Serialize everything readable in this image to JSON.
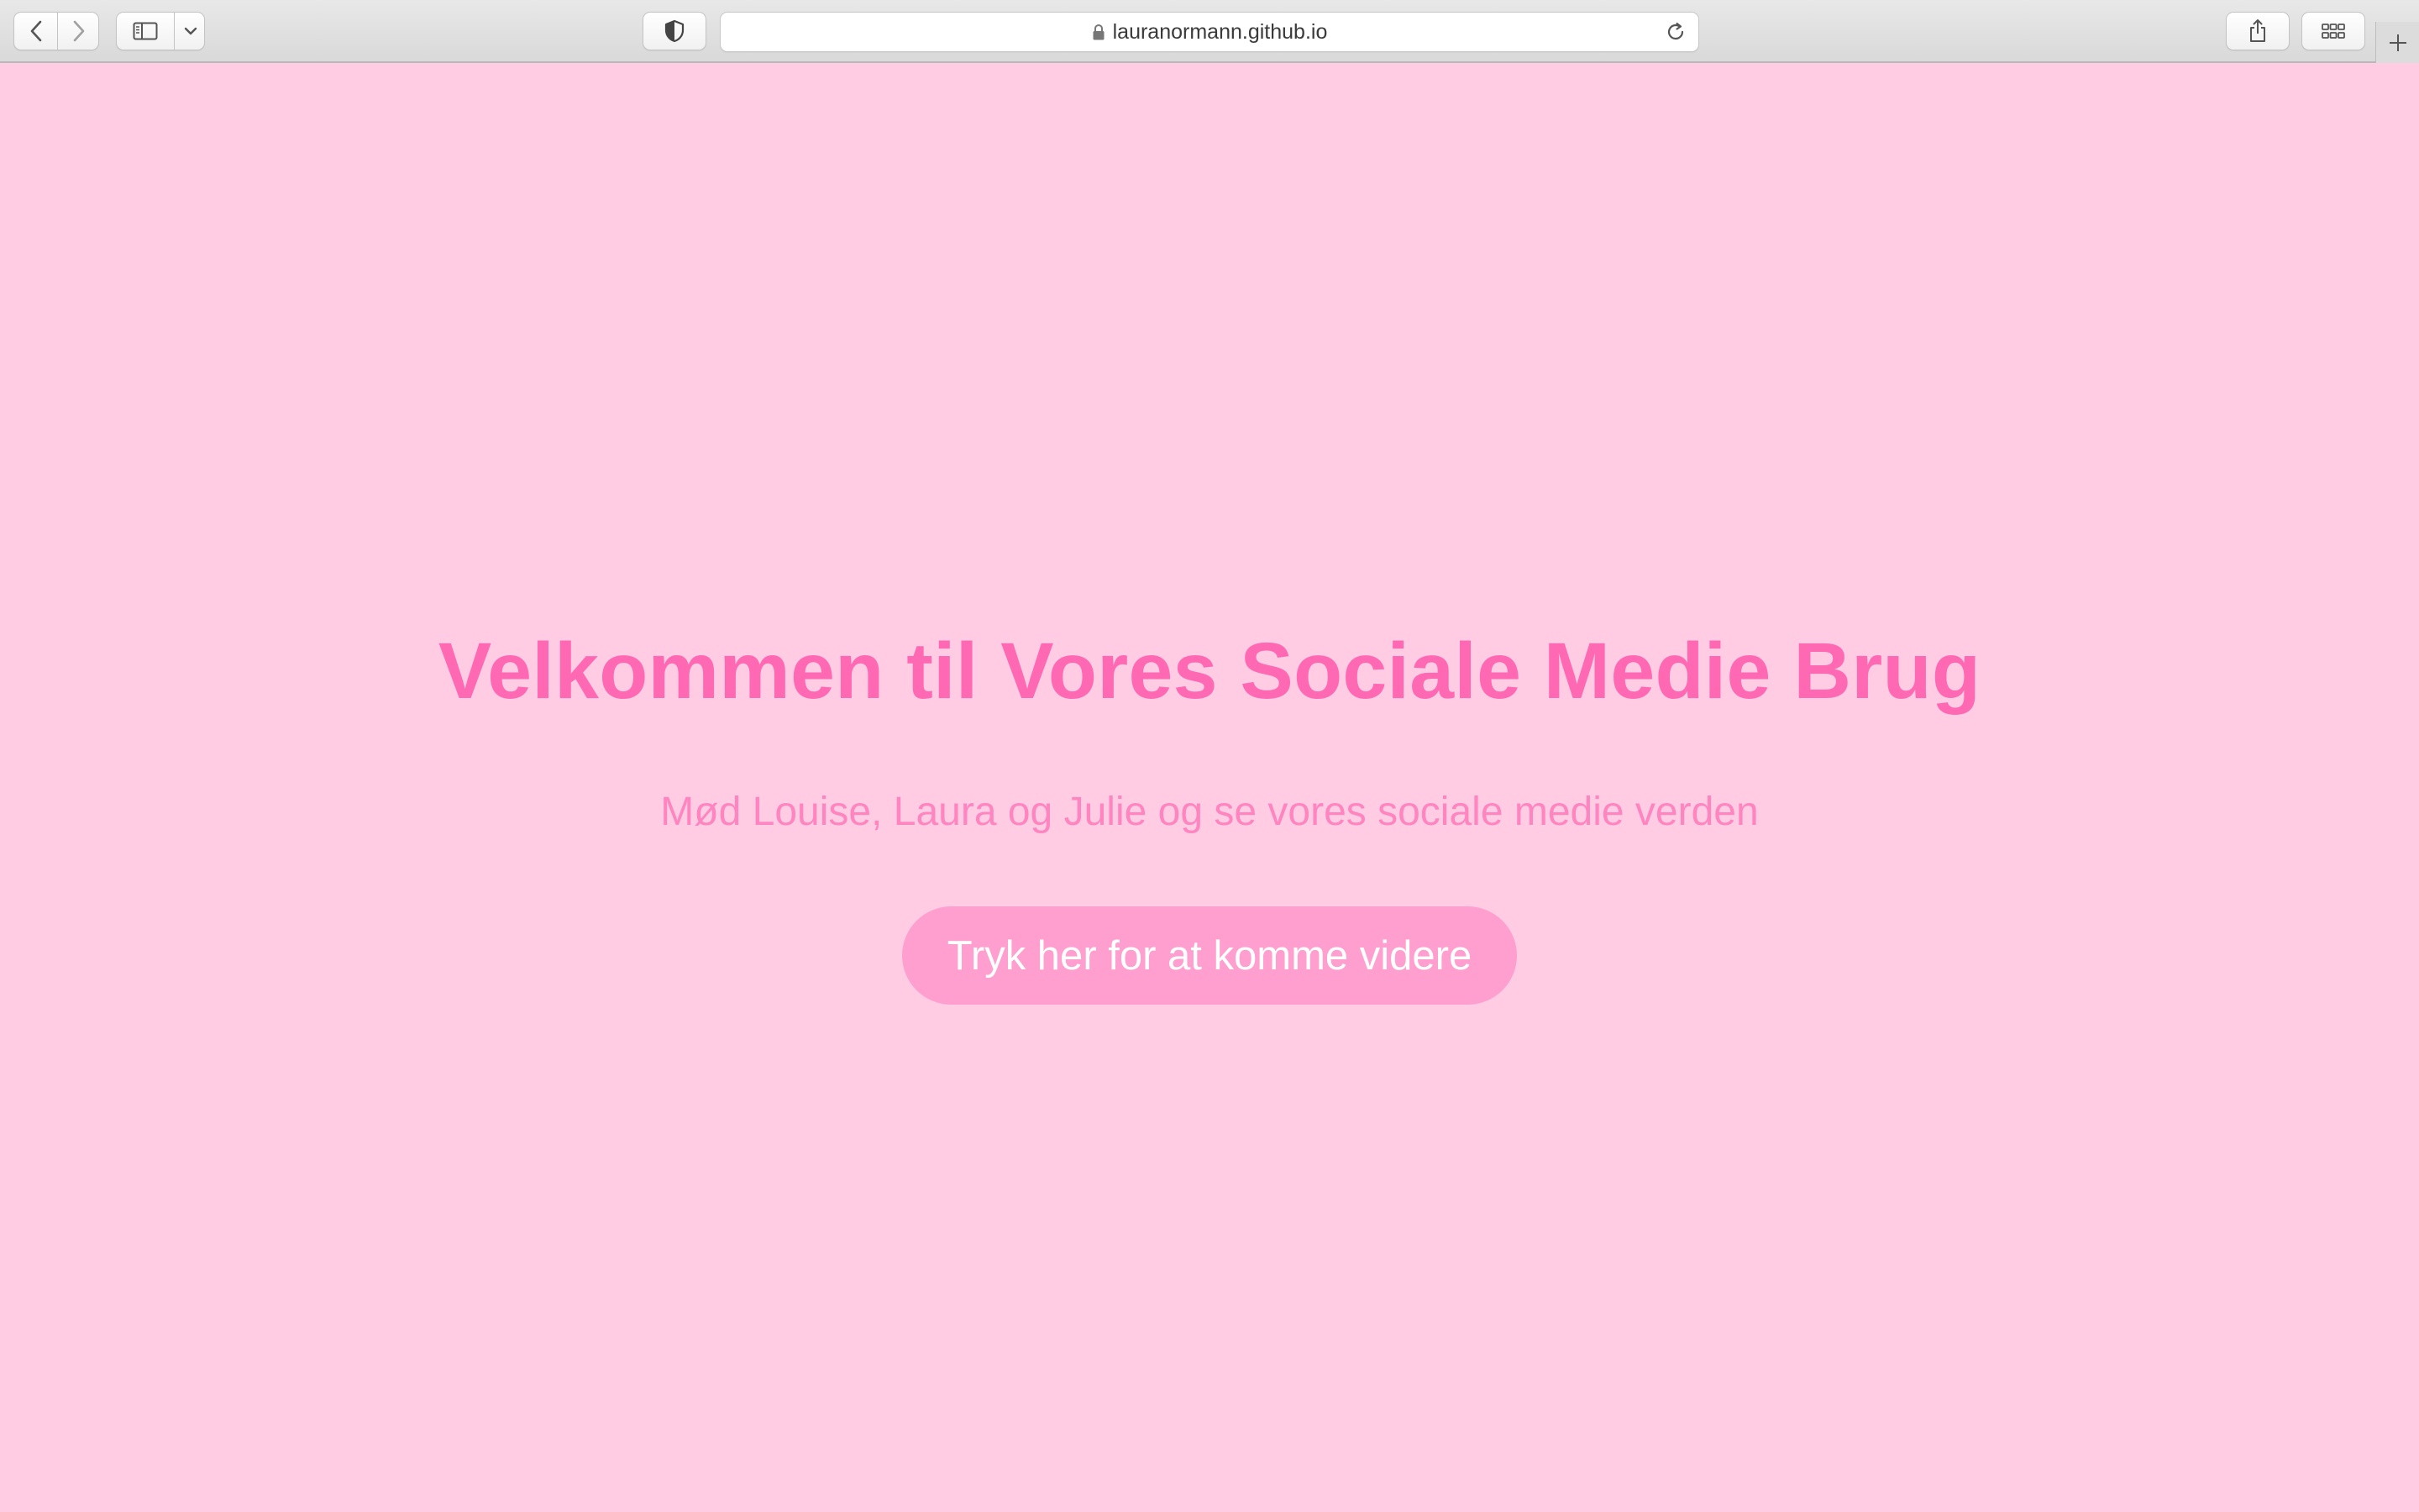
{
  "browser": {
    "url": "lauranormann.github.io",
    "icons": {
      "back": "chevron-left-icon",
      "forward": "chevron-right-icon",
      "sidebar": "sidebar-icon",
      "sidebar_menu": "chevron-down-icon",
      "privacy": "shield-icon",
      "lock": "lock-icon",
      "reload": "reload-icon",
      "share": "share-icon",
      "tab_overview": "grid-icon",
      "new_tab": "plus-icon"
    }
  },
  "page": {
    "title": "Velkommen til Vores Sociale Medie Brug",
    "subtitle": "Mød Louise, Laura og Julie og se vores sociale medie verden",
    "cta_label": "Tryk her for at komme videre"
  },
  "colors": {
    "background": "#ffcce4",
    "title": "#ff69b4",
    "subtitle": "#ff85c0",
    "button": "#ff9fcf",
    "button_text": "#ffffff"
  }
}
